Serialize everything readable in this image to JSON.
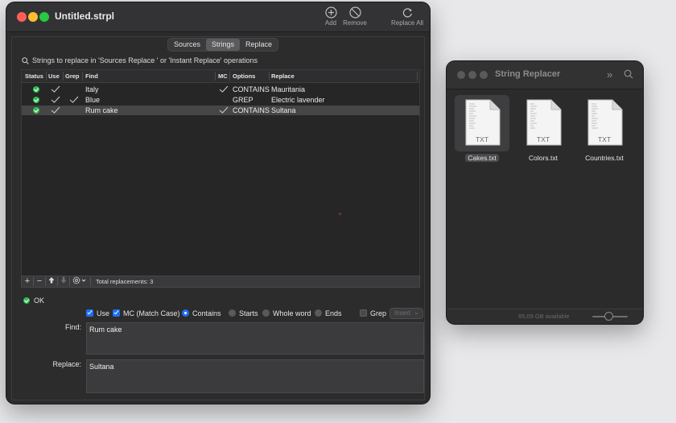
{
  "main_window": {
    "title": "Untitled.strpl",
    "toolbar": {
      "add_label": "Add",
      "remove_label": "Remove",
      "replace_all_label": "Replace All"
    },
    "tabs": [
      {
        "label": "Sources",
        "active": false
      },
      {
        "label": "Strings",
        "active": true
      },
      {
        "label": "Replace",
        "active": false
      }
    ],
    "hint": "Strings to replace in  'Sources Replace ' or  'Instant Replace' operations",
    "table": {
      "headers": {
        "status": "Status",
        "use": "Use",
        "grep": "Grep",
        "find": "Find",
        "mc": "MC",
        "options": "Options",
        "replace": "Replace"
      },
      "rows": [
        {
          "status": "ok",
          "use": true,
          "grep": false,
          "find": "Italy",
          "mc": true,
          "options": "CONTAINS",
          "replace": "Mauritania",
          "selected": false
        },
        {
          "status": "ok",
          "use": true,
          "grep": true,
          "find": "Blue",
          "mc": false,
          "options": "GREP",
          "replace": "Electric lavender",
          "selected": false
        },
        {
          "status": "ok",
          "use": true,
          "grep": false,
          "find": "Rum cake",
          "mc": true,
          "options": "CONTAINS",
          "replace": "Sultana",
          "selected": true
        }
      ]
    },
    "footer": {
      "add_row": "+",
      "remove_row": "−",
      "total": "Total replacements: 3"
    },
    "status_text": "OK",
    "options": {
      "use_label": "Use",
      "mc_label": "MC (Match Case)",
      "contains_label": "Contains",
      "starts_label": "Starts",
      "whole_word_label": "Whole word",
      "ends_label": "Ends",
      "grep_label": "Grep",
      "insert_label": "Insert"
    },
    "find_label": "Find:",
    "find_value": "Rum cake",
    "replace_label": "Replace:",
    "replace_value": "Sultana"
  },
  "side_window": {
    "title": "String Replacer",
    "files": [
      {
        "name": "Cakes.txt",
        "type": "TXT",
        "selected": true
      },
      {
        "name": "Colors.txt",
        "type": "TXT",
        "selected": false
      },
      {
        "name": "Countries.txt",
        "type": "TXT",
        "selected": false
      }
    ],
    "available": "65,09 GB available"
  }
}
